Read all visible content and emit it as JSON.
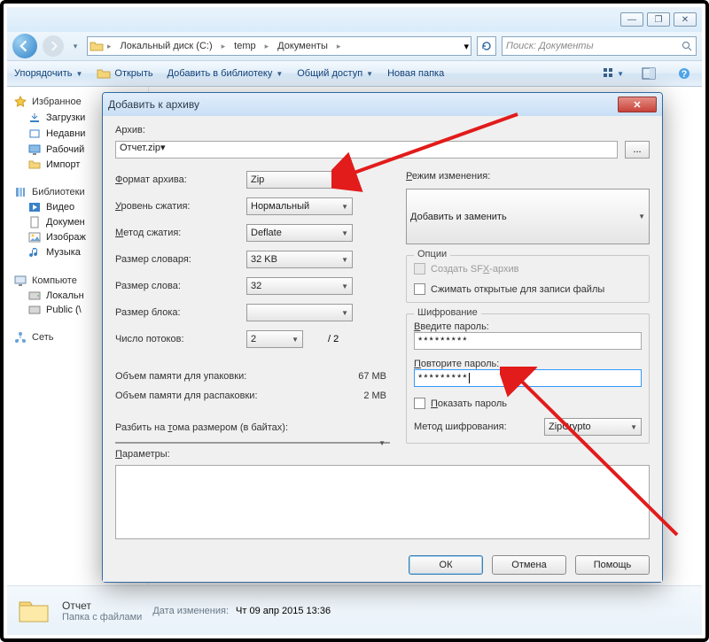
{
  "window": {
    "min_tooltip": "—",
    "max_tooltip": "❐",
    "close_tooltip": "✕"
  },
  "breadcrumb": {
    "drive": "Локальный диск (C:)",
    "p1": "temp",
    "p2": "Документы"
  },
  "search": {
    "placeholder": "Поиск: Документы"
  },
  "toolbar": {
    "organize": "Упорядочить",
    "open": "Открыть",
    "add_lib": "Добавить в библиотеку",
    "share": "Общий доступ",
    "new_folder": "Новая папка"
  },
  "sidebar": {
    "fav_hdr": "Избранное",
    "fav": {
      "downloads": "Загрузки",
      "recent": "Недавни",
      "desktop": "Рабочий",
      "import": "Импорт"
    },
    "lib_hdr": "Библиотеки",
    "lib": {
      "video": "Видео",
      "docs": "Докумен",
      "pics": "Изображ",
      "music": "Музыка"
    },
    "comp_hdr": "Компьюте",
    "comp": {
      "local": "Локальн",
      "public": "Public (\\"
    },
    "net_hdr": "Сеть"
  },
  "details": {
    "name": "Отчет",
    "sub": "Папка с файлами",
    "mod_lbl": "Дата изменения:",
    "mod_val": "Чт 09 апр 2015 13:36"
  },
  "dialog": {
    "title": "Добавить к архиву",
    "archive_lbl": "Архив:",
    "archive_val": "Отчет.zip",
    "browse": "...",
    "format_lbl": "Формат архива:",
    "format_val": "Zip",
    "level_lbl": "Уровень сжатия:",
    "level_val": "Нормальный",
    "method_lbl": "Метод сжатия:",
    "method_val": "Deflate",
    "dict_lbl": "Размер словаря:",
    "dict_val": "32 KB",
    "word_lbl": "Размер слова:",
    "word_val": "32",
    "block_lbl": "Размер блока:",
    "block_val": "",
    "threads_lbl": "Число потоков:",
    "threads_val": "2",
    "threads_total": "/ 2",
    "pack_lbl": "Объем памяти для упаковки:",
    "pack_val": "67 MB",
    "unpack_lbl": "Объем памяти для распаковки:",
    "unpack_val": "2 MB",
    "split_lbl": "Разбить на тома размером (в байтах):",
    "split_val": "",
    "params_lbl": "Параметры:",
    "params_val": "",
    "mode_lbl": "Режим изменения:",
    "mode_val": "Добавить и заменить",
    "opts_title": "Опции",
    "sfx_lbl": "Создать SFX-архив",
    "openfiles_lbl": "Сжимать открытые для записи файлы",
    "enc_title": "Шифрование",
    "pwd1_lbl": "Введите пароль:",
    "pwd1_val": "*********",
    "pwd2_lbl": "Повторите пароль:",
    "pwd2_val": "*********",
    "showpwd_lbl": "Показать пароль",
    "encmethod_lbl": "Метод шифрования:",
    "encmethod_val": "ZipCrypto",
    "ok": "ОК",
    "cancel": "Отмена",
    "help": "Помощь"
  }
}
